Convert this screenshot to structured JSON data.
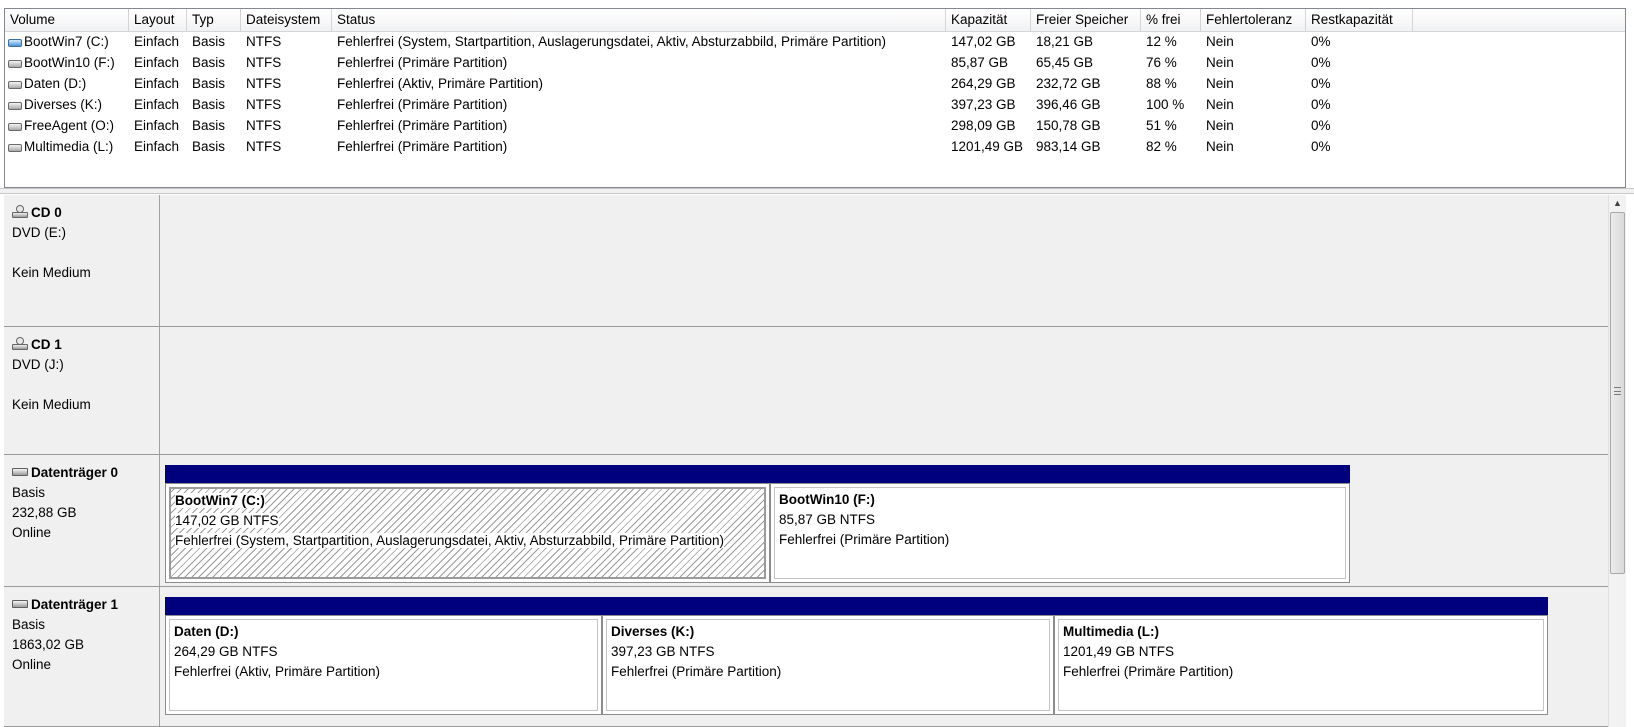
{
  "table": {
    "columns": [
      "Volume",
      "Layout",
      "Typ",
      "Dateisystem",
      "Status",
      "Kapazität",
      "Freier Speicher",
      "% frei",
      "Fehlertoleranz",
      "Restkapazität"
    ],
    "rows": [
      {
        "volume": "BootWin7 (C:)",
        "layout": "Einfach",
        "typ": "Basis",
        "fs": "NTFS",
        "status": "Fehlerfrei (System, Startpartition, Auslagerungsdatei, Aktiv, Absturzabbild, Primäre Partition)",
        "kapazitaet": "147,02 GB",
        "frei": "18,21 GB",
        "pct": "12 %",
        "fehler": "Nein",
        "rest": "0%"
      },
      {
        "volume": "BootWin10 (F:)",
        "layout": "Einfach",
        "typ": "Basis",
        "fs": "NTFS",
        "status": "Fehlerfrei (Primäre Partition)",
        "kapazitaet": "85,87 GB",
        "frei": "65,45 GB",
        "pct": "76 %",
        "fehler": "Nein",
        "rest": "0%"
      },
      {
        "volume": "Daten (D:)",
        "layout": "Einfach",
        "typ": "Basis",
        "fs": "NTFS",
        "status": "Fehlerfrei (Aktiv, Primäre Partition)",
        "kapazitaet": "264,29 GB",
        "frei": "232,72 GB",
        "pct": "88 %",
        "fehler": "Nein",
        "rest": "0%"
      },
      {
        "volume": "Diverses (K:)",
        "layout": "Einfach",
        "typ": "Basis",
        "fs": "NTFS",
        "status": "Fehlerfrei (Primäre Partition)",
        "kapazitaet": "397,23 GB",
        "frei": "396,46 GB",
        "pct": "100 %",
        "fehler": "Nein",
        "rest": "0%"
      },
      {
        "volume": "FreeAgent (O:)",
        "layout": "Einfach",
        "typ": "Basis",
        "fs": "NTFS",
        "status": "Fehlerfrei (Primäre Partition)",
        "kapazitaet": "298,09 GB",
        "frei": "150,78 GB",
        "pct": "51 %",
        "fehler": "Nein",
        "rest": "0%"
      },
      {
        "volume": "Multimedia (L:)",
        "layout": "Einfach",
        "typ": "Basis",
        "fs": "NTFS",
        "status": "Fehlerfrei (Primäre Partition)",
        "kapazitaet": "1201,49 GB",
        "frei": "983,14 GB",
        "pct": "82 %",
        "fehler": "Nein",
        "rest": "0%"
      }
    ]
  },
  "disks": {
    "cd0": {
      "title": "CD 0",
      "line1": "DVD (E:)",
      "line2": "Kein Medium"
    },
    "cd1": {
      "title": "CD 1",
      "line1": "DVD (J:)",
      "line2": "Kein Medium"
    },
    "disk0": {
      "title": "Datenträger 0",
      "type": "Basis",
      "size": "232,88 GB",
      "state": "Online",
      "partitions": [
        {
          "name": "BootWin7  (C:)",
          "size": "147,02 GB NTFS",
          "status": "Fehlerfrei (System, Startpartition, Auslagerungsdatei, Aktiv, Absturzabbild, Primäre Partition)"
        },
        {
          "name": "BootWin10  (F:)",
          "size": "85,87 GB NTFS",
          "status": "Fehlerfrei (Primäre Partition)"
        }
      ]
    },
    "disk1": {
      "title": "Datenträger 1",
      "type": "Basis",
      "size": "1863,02 GB",
      "state": "Online",
      "partitions": [
        {
          "name": "Daten  (D:)",
          "size": "264,29 GB NTFS",
          "status": "Fehlerfrei (Aktiv, Primäre Partition)"
        },
        {
          "name": "Diverses  (K:)",
          "size": "397,23 GB NTFS",
          "status": "Fehlerfrei (Primäre Partition)"
        },
        {
          "name": "Multimedia  (L:)",
          "size": "1201,49 GB NTFS",
          "status": "Fehlerfrei (Primäre Partition)"
        }
      ]
    }
  },
  "colors": {
    "partition_bar": "#00007f",
    "pane_bg": "#f0f0f0"
  }
}
